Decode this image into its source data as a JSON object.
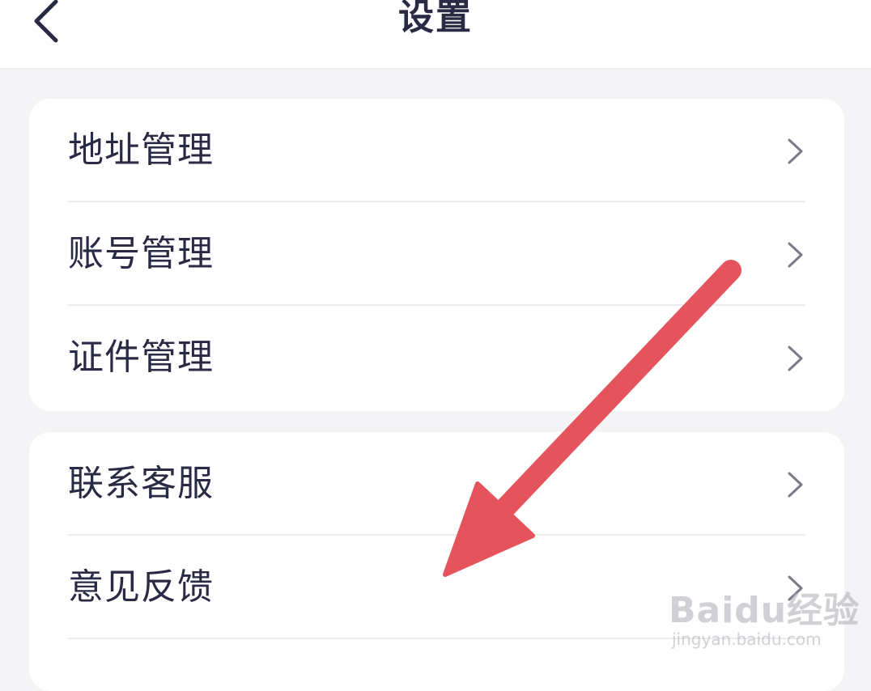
{
  "header": {
    "title": "设置",
    "back_icon": "chevron-left-icon"
  },
  "groups": [
    {
      "items": [
        {
          "label": "地址管理",
          "icon": "chevron-right-icon"
        },
        {
          "label": "账号管理",
          "icon": "chevron-right-icon"
        },
        {
          "label": "证件管理",
          "icon": "chevron-right-icon"
        }
      ]
    },
    {
      "items": [
        {
          "label": "联系客服",
          "icon": "chevron-right-icon"
        },
        {
          "label": "意见反馈",
          "icon": "chevron-right-icon"
        }
      ]
    }
  ],
  "annotation": {
    "type": "arrow",
    "color": "#e5535c",
    "points_to": "意见反馈"
  },
  "watermark": {
    "brand": "Baidu经验",
    "url": "jingyan.baidu.com"
  },
  "colors": {
    "background": "#f4f4f6",
    "card": "#ffffff",
    "text": "#2b2a45",
    "chevron": "#7a7a88",
    "divider": "#ececef"
  }
}
